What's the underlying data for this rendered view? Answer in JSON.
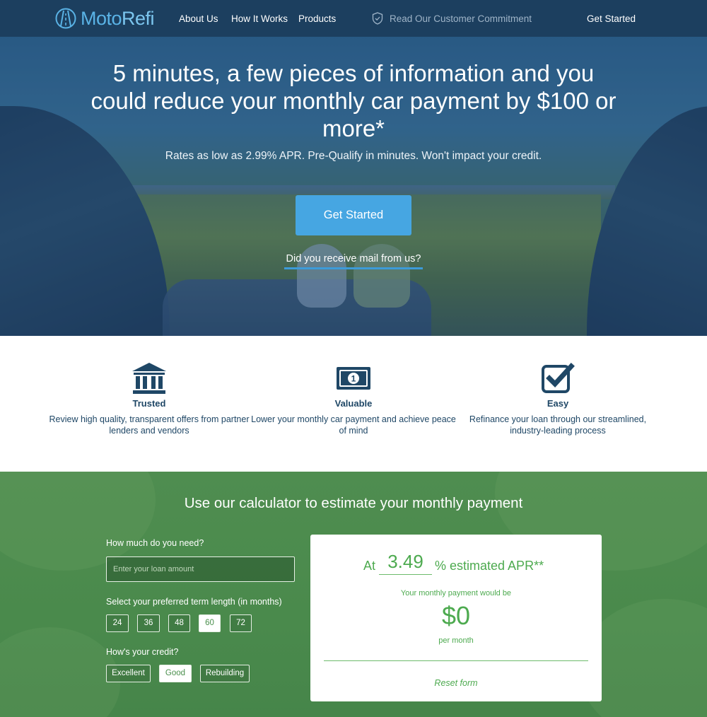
{
  "nav": {
    "brand_part1": "Moto",
    "brand_part2": "Refi",
    "links": [
      "About Us",
      "How It Works",
      "Products"
    ],
    "commitment": "Read Our Customer Commitment",
    "get_started": "Get Started"
  },
  "hero": {
    "headline": "5 minutes, a few pieces of information and you could reduce your monthly car payment by $100 or more*",
    "subline": "Rates as low as 2.99% APR. Pre-Qualify in minutes. Won't impact your credit.",
    "cta": "Get Started",
    "mail_link": "Did you receive mail from us?"
  },
  "features": [
    {
      "icon": "bank-icon",
      "title": "Trusted",
      "desc": "Review high quality, transparent offers from partner lenders and vendors"
    },
    {
      "icon": "money-icon",
      "title": "Valuable",
      "desc": "Lower your monthly car payment and achieve peace of mind"
    },
    {
      "icon": "checkbox-icon",
      "title": "Easy",
      "desc": "Refinance your loan through our streamlined, industry-leading process"
    }
  ],
  "calculator": {
    "title": "Use our calculator to estimate your monthly payment",
    "loan_label": "How much do you need?",
    "loan_placeholder": "Enter your loan amount",
    "term_label": "Select your preferred term length (in months)",
    "terms": [
      "24",
      "36",
      "48",
      "60",
      "72"
    ],
    "selected_term": "60",
    "credit_label": "How's your credit?",
    "credit_options": [
      "Excellent",
      "Good",
      "Rebuilding"
    ],
    "selected_credit": "Good",
    "result": {
      "at": "At",
      "apr": "3.49",
      "apr_suffix": "% estimated APR**",
      "payment_label": "Your monthly payment would be",
      "payment": "$0",
      "per_month": "per month",
      "reset": "Reset form"
    }
  },
  "colors": {
    "nav_bg": "#1c3f5f",
    "brand_blue": "#5ab3e6",
    "cta_blue": "#46a6e2",
    "feature_text": "#1f4766",
    "calc_green": "#4a8a4c",
    "result_green": "#4daa4f"
  }
}
